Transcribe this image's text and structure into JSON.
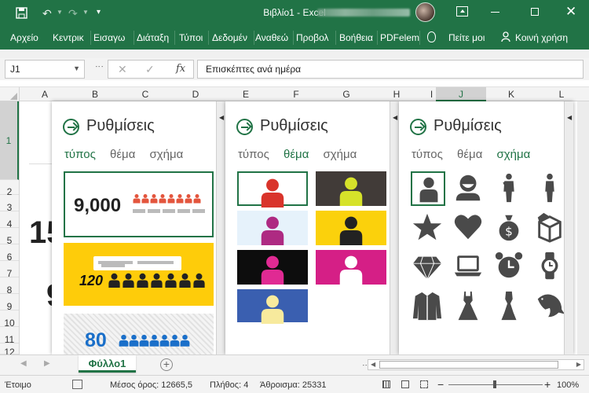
{
  "titlebar": {
    "title": "Βιβλίο1 - Excel",
    "qat_more": "▾"
  },
  "ribbon": {
    "tabs": [
      "Αρχείο",
      "Κεντρικ",
      "Εισαγω",
      "Διάταξη",
      "Τύποι",
      "Δεδομέν",
      "Αναθεώ",
      "Προβολ",
      "Βοήθεια",
      "PDFelem",
      "Πείτε μοι",
      "Κοινή χρήση"
    ]
  },
  "formula": {
    "namebox": "J1",
    "value": "Επισκέπτες ανά ημέρα",
    "fx": "fx",
    "cancel": "✕",
    "confirm": "✓"
  },
  "columns": [
    "A",
    "B",
    "C",
    "D",
    "E",
    "F",
    "G",
    "H",
    "I",
    "J",
    "K",
    "L"
  ],
  "rows": [
    "1",
    "2",
    "3",
    "4",
    "5",
    "6",
    "7",
    "8",
    "9",
    "10",
    "11",
    "12"
  ],
  "selection": {
    "column": "J",
    "row": "1"
  },
  "sheet_fragments": {
    "big1": "15",
    "big2": "9"
  },
  "panes": [
    {
      "title": "Ρυθμίσεις",
      "tabs": [
        "τύπος",
        "θέμα",
        "σχήμα"
      ],
      "active_tab": 0,
      "cards": [
        {
          "value": "9,000",
          "style": "light",
          "icon_color": "#e3553d",
          "selected": true
        },
        {
          "value": "120",
          "style": "yellow",
          "icon_color": "#222222"
        },
        {
          "value": "80",
          "style": "striped",
          "icon_color": "#1a6fc9"
        }
      ]
    },
    {
      "title": "Ρυθμίσεις",
      "tabs": [
        "τύπος",
        "θέμα",
        "σχήμα"
      ],
      "active_tab": 1,
      "themes": [
        {
          "bg": "#ffffff",
          "fg": "#d9342b",
          "selected": true
        },
        {
          "bg": "#413b38",
          "fg": "#d6e22a"
        },
        {
          "bg": "#e6f2fb",
          "fg": "#ae2a82"
        },
        {
          "bg": "#fbd10c",
          "fg": "#222222"
        },
        {
          "bg": "#0d0d0d",
          "fg": "#e02a93"
        },
        {
          "bg": "#d51f86",
          "fg": "#ffffff"
        },
        {
          "bg": "#3a5fb0",
          "fg": "#f7ea9d"
        }
      ]
    },
    {
      "title": "Ρυθμίσεις",
      "tabs": [
        "τύπος",
        "θέμα",
        "σχήμα"
      ],
      "active_tab": 2,
      "shapes": [
        "person-icon",
        "face-icon",
        "man-icon",
        "woman-icon",
        "star-icon",
        "heart-icon",
        "money-bag-icon",
        "box-icon",
        "diamond-icon",
        "laptop-icon",
        "alarm-clock-icon",
        "watch-icon",
        "jacket-icon",
        "dress-icon",
        "gown-icon",
        "dolphin-icon"
      ]
    }
  ],
  "sheetbar": {
    "tab": "Φύλλο1",
    "add": "+"
  },
  "status": {
    "ready": "Έτοιμο",
    "average": "Μέσος όρος: 12665,5",
    "count": "Πλήθος: 4",
    "sum": "Άθροισμα: 25331",
    "zoom": "100%",
    "minus": "−",
    "plus": "+"
  },
  "colors": {
    "accent": "#217346"
  }
}
